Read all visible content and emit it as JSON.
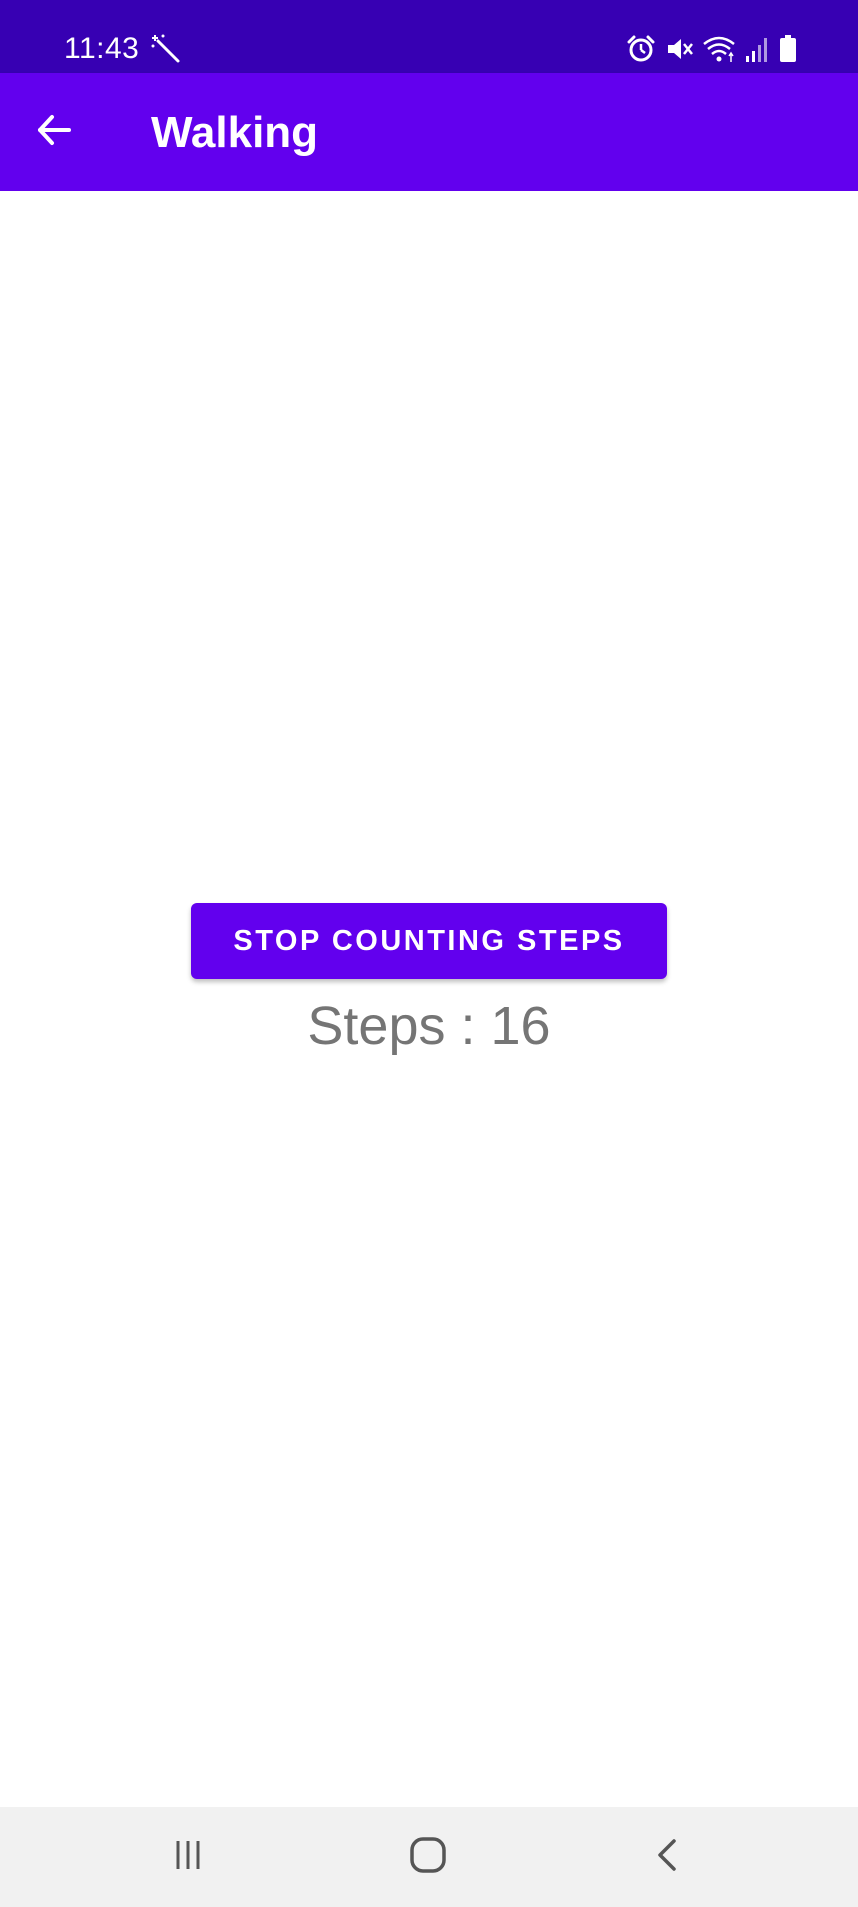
{
  "status_bar": {
    "time": "11:43",
    "background": "#3700b3",
    "icons": [
      "magic-wand-icon",
      "alarm-icon",
      "mute-icon",
      "wifi-icon",
      "signal-icon",
      "battery-icon"
    ]
  },
  "app_bar": {
    "title": "Walking",
    "background": "#6200ee",
    "back_icon": "arrow-back-icon"
  },
  "main": {
    "stop_button_label": "STOP COUNTING STEPS",
    "steps_label": "Steps :",
    "steps_value": "16",
    "accent": "#6200ee",
    "text_color": "#757575"
  },
  "nav_bar": {
    "buttons": [
      "recent-apps-icon",
      "home-icon",
      "back-icon"
    ]
  }
}
